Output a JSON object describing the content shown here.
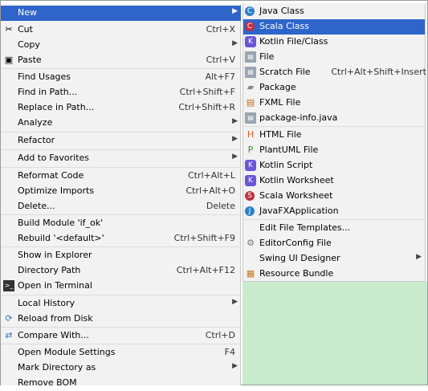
{
  "context_menu": {
    "items": [
      {
        "label": "New",
        "arrow": true
      },
      {
        "label": "Cut",
        "shortcut": "Ctrl+X",
        "icon": "scissors-icon"
      },
      {
        "label": "Copy",
        "arrow": true
      },
      {
        "label": "Paste",
        "shortcut": "Ctrl+V",
        "icon": "paste-icon"
      },
      {
        "label": "Find Usages",
        "shortcut": "Alt+F7"
      },
      {
        "label": "Find in Path...",
        "shortcut": "Ctrl+Shift+F"
      },
      {
        "label": "Replace in Path...",
        "shortcut": "Ctrl+Shift+R"
      },
      {
        "label": "Analyze",
        "arrow": true
      },
      {
        "label": "Refactor",
        "arrow": true
      },
      {
        "label": "Add to Favorites",
        "arrow": true
      },
      {
        "label": "Reformat Code",
        "shortcut": "Ctrl+Alt+L"
      },
      {
        "label": "Optimize Imports",
        "shortcut": "Ctrl+Alt+O"
      },
      {
        "label": "Delete...",
        "shortcut": "Delete"
      },
      {
        "label": "Build Module 'if_ok'"
      },
      {
        "label": "Rebuild '<default>'",
        "shortcut": "Ctrl+Shift+F9"
      },
      {
        "label": "Show in Explorer"
      },
      {
        "label": "Directory Path",
        "shortcut": "Ctrl+Alt+F12"
      },
      {
        "label": "Open in Terminal",
        "icon": "terminal-icon"
      },
      {
        "label": "Local History",
        "arrow": true
      },
      {
        "label": "Reload from Disk",
        "icon": "reload-icon"
      },
      {
        "label": "Compare With...",
        "shortcut": "Ctrl+D",
        "icon": "compare-icon"
      },
      {
        "label": "Open Module Settings",
        "shortcut": "F4"
      },
      {
        "label": "Mark Directory as",
        "arrow": true
      },
      {
        "label": "Remove BOM"
      }
    ]
  },
  "submenu": {
    "items": [
      {
        "label": "Java Class",
        "icon": "java-class-icon",
        "glyph": "C"
      },
      {
        "label": "Scala Class",
        "icon": "scala-class-icon",
        "glyph": "C"
      },
      {
        "label": "Kotlin File/Class",
        "icon": "kotlin-icon",
        "glyph": "K"
      },
      {
        "label": "File",
        "icon": "file-icon",
        "glyph": "▤"
      },
      {
        "label": "Scratch File",
        "shortcut": "Ctrl+Alt+Shift+Insert",
        "icon": "scratch-file-icon",
        "glyph": "▤"
      },
      {
        "label": "Package",
        "icon": "package-icon",
        "glyph": "▰"
      },
      {
        "label": "FXML File",
        "icon": "fxml-icon",
        "glyph": "▤"
      },
      {
        "label": "package-info.java",
        "icon": "java-file-icon",
        "glyph": "▤"
      },
      {
        "label": "HTML File",
        "icon": "html-icon",
        "glyph": "H"
      },
      {
        "label": "PlantUML File",
        "icon": "plantuml-icon",
        "glyph": "P"
      },
      {
        "label": "Kotlin Script",
        "icon": "kotlin-script-icon",
        "glyph": "K"
      },
      {
        "label": "Kotlin Worksheet",
        "icon": "kotlin-worksheet-icon",
        "glyph": "K"
      },
      {
        "label": "Scala Worksheet",
        "icon": "scala-worksheet-icon",
        "glyph": "S"
      },
      {
        "label": "JavaFXApplication",
        "icon": "javafx-icon",
        "glyph": "J"
      },
      {
        "label": "Edit File Templates..."
      },
      {
        "label": "EditorConfig File",
        "icon": "gear-icon",
        "glyph": "⚙"
      },
      {
        "label": "Swing UI Designer",
        "arrow": true
      },
      {
        "label": "Resource Bundle",
        "icon": "resource-bundle-icon",
        "glyph": "▦"
      }
    ]
  },
  "colors": {
    "selection": "#2f65ca",
    "menu_bg": "#f2f2f2",
    "workspace_green": "#c8ebcd"
  }
}
